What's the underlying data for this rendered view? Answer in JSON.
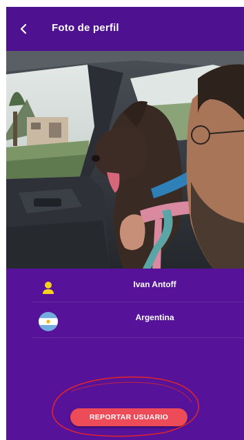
{
  "header": {
    "title": "Foto de perfil",
    "back_icon": "chevron-left-icon"
  },
  "profile": {
    "photo_description": "profile-photo",
    "name": "Ivan Antoff",
    "name_icon": "user-icon",
    "country": "Argentina",
    "country_icon": "argentina-flag-icon"
  },
  "actions": {
    "report_label": "REPORTAR USUARIO"
  },
  "colors": {
    "background": "#56139a",
    "header": "#4e1190",
    "accent_button": "#ee4b59",
    "user_icon": "#f6d21c",
    "annotation": "#e0242c"
  }
}
